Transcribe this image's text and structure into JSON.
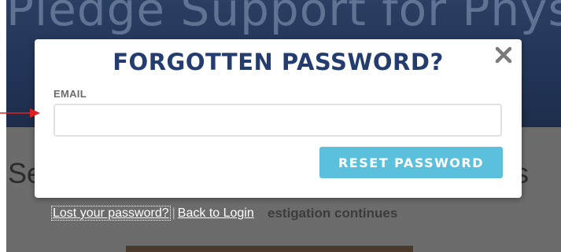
{
  "background": {
    "banner_title": "Pledge Support for Physicia",
    "heading_left": "Se",
    "heading_right": "s",
    "teaser": "estigation continues"
  },
  "modal": {
    "title": "FORGOTTEN PASSWORD?",
    "close_icon": "close-icon",
    "email_label": "EMAIL",
    "email_value": "",
    "email_placeholder": "",
    "reset_label": "RESET PASSWORD"
  },
  "links": {
    "lost_password": "Lost your password?",
    "separator": "|",
    "back_to_login": "Back to Login"
  },
  "colors": {
    "title": "#243d6e",
    "reset_button": "#5bc0dc",
    "annotation_arrow": "#e02020"
  }
}
